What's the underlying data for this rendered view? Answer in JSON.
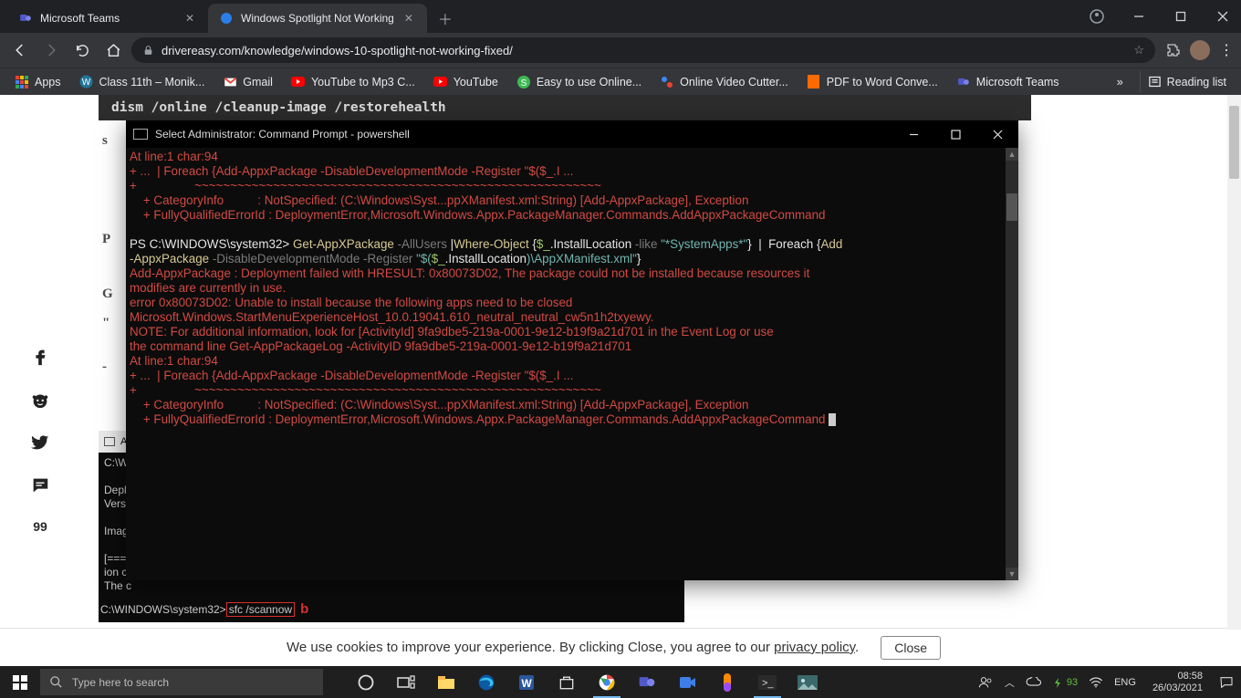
{
  "browser": {
    "tabs": [
      {
        "title": "Microsoft Teams",
        "active": false
      },
      {
        "title": "Windows Spotlight Not Working",
        "active": true
      }
    ],
    "url": "drivereasy.com/knowledge/windows-10-spotlight-not-working-fixed/",
    "bookmarks": [
      {
        "label": "Apps"
      },
      {
        "label": "Class 11th – Monik..."
      },
      {
        "label": "Gmail"
      },
      {
        "label": "YouTube to Mp3 C..."
      },
      {
        "label": "YouTube"
      },
      {
        "label": "Easy to use Online..."
      },
      {
        "label": "Online Video Cutter..."
      },
      {
        "label": "PDF to Word Conve..."
      },
      {
        "label": "Microsoft Teams"
      }
    ],
    "reading_list_label": "Reading list"
  },
  "article": {
    "code_line": "dism /online /cleanup-image /restorehealth",
    "side_letters": [
      "s",
      "P",
      "G",
      "\"",
      "-"
    ],
    "cmd2": {
      "title": "A",
      "lines": "C:\\WI\n\nDeplo\nVersi\n\nImage\n\n[====\nion c\nThe c",
      "prompt": "C:\\WINDOWS\\system32>",
      "highlighted": "sfc /scannow",
      "marker": "b"
    },
    "social_count": "99"
  },
  "ps_window": {
    "title": "Select Administrator: Command Prompt - powershell",
    "body_lines": [
      {
        "cls": "red",
        "text": "At line:1 char:94"
      },
      {
        "cls": "red",
        "text": "+ ...  | Foreach {Add-AppxPackage -DisableDevelopmentMode -Register \"$($_.I ..."
      },
      {
        "cls": "red",
        "text": "+                 ~~~~~~~~~~~~~~~~~~~~~~~~~~~~~~~~~~~~~~~~~~~~~~~~~~~~~~~~~"
      },
      {
        "cls": "red",
        "text": "    + CategoryInfo          : NotSpecified: (C:\\Windows\\Syst...ppXManifest.xml:String) [Add-AppxPackage], Exception"
      },
      {
        "cls": "red",
        "text": "    + FullyQualifiedErrorId : DeploymentError,Microsoft.Windows.Appx.PackageManager.Commands.AddAppxPackageCommand"
      },
      {
        "cls": "whi",
        "text": ""
      },
      {
        "cls": "mix1",
        "text": ""
      },
      {
        "cls": "mix2",
        "text": ""
      },
      {
        "cls": "red",
        "text": "Add-AppxPackage : Deployment failed with HRESULT: 0x80073D02, The package could not be installed because resources it"
      },
      {
        "cls": "red",
        "text": "modifies are currently in use."
      },
      {
        "cls": "red",
        "text": "error 0x80073D02: Unable to install because the following apps need to be closed"
      },
      {
        "cls": "red",
        "text": "Microsoft.Windows.StartMenuExperienceHost_10.0.19041.610_neutral_neutral_cw5n1h2txyewy."
      },
      {
        "cls": "red",
        "text": "NOTE: For additional information, look for [ActivityId] 9fa9dbe5-219a-0001-9e12-b19f9a21d701 in the Event Log or use"
      },
      {
        "cls": "red",
        "text": "the command line Get-AppPackageLog -ActivityID 9fa9dbe5-219a-0001-9e12-b19f9a21d701"
      },
      {
        "cls": "red",
        "text": "At line:1 char:94"
      },
      {
        "cls": "red",
        "text": "+ ...  | Foreach {Add-AppxPackage -DisableDevelopmentMode -Register \"$($_.I ..."
      },
      {
        "cls": "red",
        "text": "+                 ~~~~~~~~~~~~~~~~~~~~~~~~~~~~~~~~~~~~~~~~~~~~~~~~~~~~~~~~~"
      },
      {
        "cls": "red",
        "text": "    + CategoryInfo          : NotSpecified: (C:\\Windows\\Syst...ppXManifest.xml:String) [Add-AppxPackage], Exception"
      },
      {
        "cls": "red",
        "text": "    + FullyQualifiedErrorId : DeploymentError,Microsoft.Windows.Appx.PackageManager.Commands.AddAppxPackageCommand"
      }
    ],
    "cmd_mixed": {
      "prompt": "PS C:\\WINDOWS\\system32> ",
      "l1": {
        "a": "Get-AppXPackage ",
        "b": "-AllUsers ",
        "c": "|",
        "d": "Where-Object ",
        "e": "{",
        "f": "$_",
        "g": ".InstallLocation ",
        "h": "-like ",
        "i": "\"*SystemApps*\"",
        "j": "}  |  Foreach {",
        "k": "Add"
      },
      "l2": {
        "a": "-AppxPackage ",
        "b": "-DisableDevelopmentMode -Register ",
        "c": "\"$(",
        "d": "$_",
        "e": ".InstallLocation",
        "f": ")",
        "g": "\\AppXManifest.xml",
        "h": "\"",
        "i": "}"
      }
    }
  },
  "cookie": {
    "text_before": "We use cookies to improve your experience. By clicking Close, you agree to our ",
    "link": "privacy policy",
    "text_after": ".",
    "button": "Close"
  },
  "taskbar": {
    "search_placeholder": "Type here to search",
    "battery": "93",
    "lang": "ENG",
    "time": "08:58",
    "date": "26/03/2021"
  }
}
